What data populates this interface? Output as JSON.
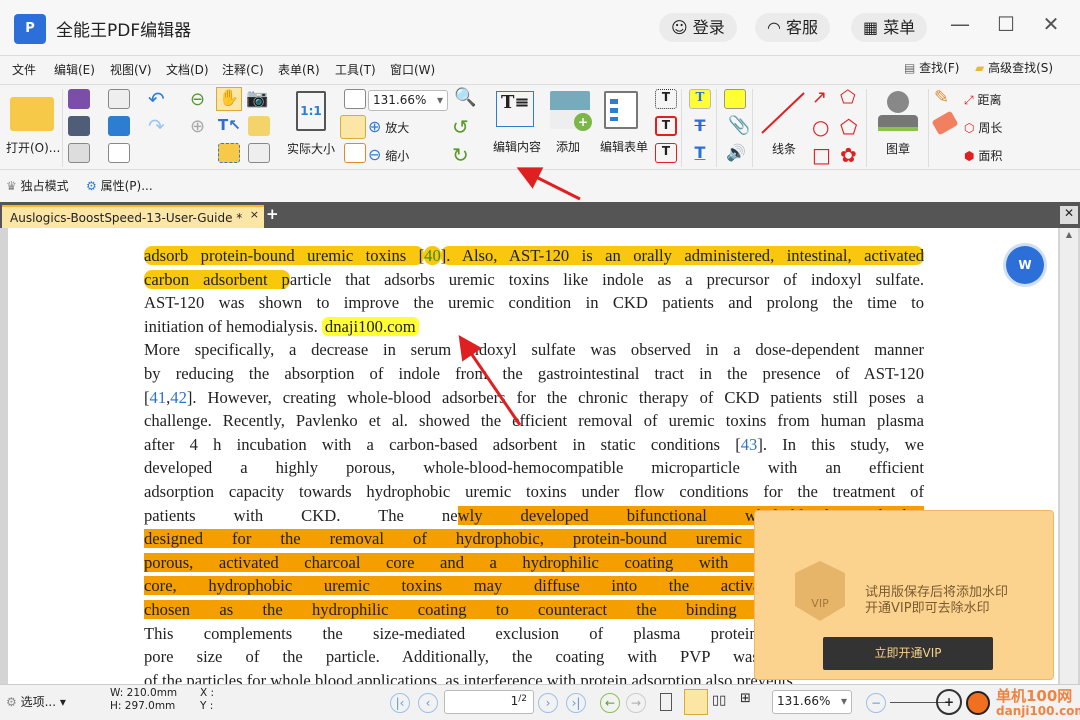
{
  "app": {
    "title": "全能王PDF编辑器",
    "logo": "P",
    "login": "登录",
    "service": "客服",
    "menu": "菜单"
  },
  "menubar": {
    "items": [
      "文件",
      "编辑(E)",
      "视图(V)",
      "文档(D)",
      "注释(C)",
      "表单(R)",
      "工具(T)",
      "窗口(W)"
    ],
    "find": "查找(F)",
    "advanced_find": "高级查找(S)"
  },
  "toolbar": {
    "open": "打开(O)...",
    "actual_size": "实际大小",
    "zoom_value": "131.66%",
    "zoom_in": "放大",
    "zoom_out": "缩小",
    "edit_content": "编辑内容",
    "add": "添加",
    "edit_form": "编辑表单",
    "lines": "线条",
    "stamp": "图章",
    "distance": "距离",
    "perimeter": "周长",
    "area": "面积",
    "one_to_one": "1:1"
  },
  "row2": {
    "exclusive": "独占模式",
    "properties": "属性(P)..."
  },
  "tab": {
    "name": "Auslogics-BoostSpeed-13-User-Guide *",
    "close": "×",
    "add": "+"
  },
  "document": {
    "lines": [
      [
        {
          "t": "adsorb protein-bound uremic toxins [",
          "h": "y"
        },
        {
          "t": "40",
          "h": "y",
          "c": "g"
        },
        {
          "t": "]. Also, AST-120 is an orally administered, intestinal, activated",
          "h": "y"
        }
      ],
      [
        {
          "t": "carbon adsorbent p",
          "h": "y"
        },
        {
          "t": "article that adsorbs uremic toxins like indole as a precursor of indoxyl sulfate."
        }
      ],
      [
        {
          "t": "AST-120 was shown to improve the uremic condition in CKD patients and prolong the time to"
        }
      ],
      [
        {
          "t": "initiation of hemodialysis. "
        },
        {
          "t": "dnaji100.com",
          "h": "w"
        }
      ],
      [
        {
          "t": "More specifically, a decrease in serum indoxyl sulfate was observed in a dose-dependent manner"
        }
      ],
      [
        {
          "t": "by reducing the absorption of indole from the gastrointestinal tract in the presence of AST-120"
        }
      ],
      [
        {
          "t": "["
        },
        {
          "t": "41",
          "c": "b"
        },
        {
          "t": ","
        },
        {
          "t": "42",
          "c": "b"
        },
        {
          "t": "]. However, creating whole-blood adsorbers for the chronic therapy of CKD patients still poses a"
        }
      ],
      [
        {
          "t": "challenge. Recently, Pavlenko et al. showed the efficient removal of uremic toxins from human plasma"
        }
      ],
      [
        {
          "t": "after 4 h incubation with a carbon-based adsorbent in static conditions ["
        },
        {
          "t": "43",
          "c": "b"
        },
        {
          "t": "]. In this study, we"
        }
      ],
      [
        {
          "t": "developed a highly porous, whole-blood-hemocompatible microparticle with an efficient"
        }
      ],
      [
        {
          "t": "adsorption capacity towards hydrophobic uremic toxins under flow conditions for the treatment of"
        }
      ],
      [
        {
          "t": "patients with CKD. The ne"
        },
        {
          "t": "wly developed bifunctional whole-blood adsorber",
          "h": "o"
        }
      ],
      [
        {
          "t": "designed for the removal of hydrophobic, protein-bound uremic toxins and cons",
          "h": "o"
        }
      ],
      [
        {
          "t": "porous, activated charcoal core and a hydrophilic coating with PVP. Due to the",
          "h": "o"
        }
      ],
      [
        {
          "t": "core, hydrophobic uremic toxins may diffuse into the activated charcoal and",
          "h": "o"
        }
      ],
      [
        {
          "t": "chosen as the hydrophilic coating to counteract the binding of plasma protei",
          "h": "o"
        }
      ],
      [
        {
          "t": "This complements the size-mediated exclusion of plasma proteins from the hy"
        }
      ],
      [
        {
          "t": "pore size of the particle. Additionally, the coating with PVP was selected to indu"
        }
      ],
      [
        {
          "t": "of the particles for whole blood applications, as interference with protein adsorption also prevents"
        }
      ]
    ]
  },
  "vip": {
    "line1": "试用版保存后将添加水印",
    "line2": "开通VIP即可去除水印",
    "button": "立即开通VIP",
    "badge": "VIP"
  },
  "status": {
    "options": "选项...",
    "width": "W: 210.0mm",
    "height": "H: 297.0mm",
    "x": "X :",
    "y": "Y :",
    "page": "1",
    "pages": "/2",
    "zoom": "131.66%",
    "watermark": "单机100网",
    "watermark2": "danji100.com"
  },
  "colors": {
    "highlight_yellow": "#f9c80e",
    "highlight_orange": "#f59e00",
    "annotation_arrow": "#e02020",
    "accent": "#2d6fd8"
  }
}
